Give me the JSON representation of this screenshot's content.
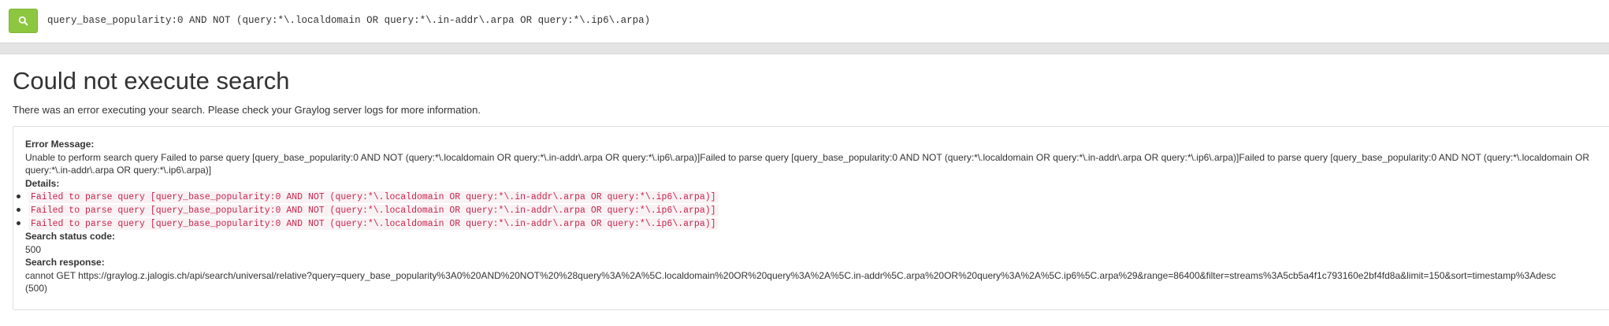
{
  "search": {
    "query": "query_base_popularity:0 AND NOT (query:*\\.localdomain OR query:*\\.in-addr\\.arpa OR query:*\\.ip6\\.arpa)",
    "button_icon": "search-icon",
    "button_color": "#8dc63f"
  },
  "error": {
    "title": "Could not execute search",
    "description": "There was an error executing your search. Please check your Graylog server logs for more information.",
    "message_label": "Error Message:",
    "message_text": "Unable to perform search query Failed to parse query [query_base_popularity:0 AND NOT (query:*\\.localdomain OR query:*\\.in-addr\\.arpa OR query:*\\.ip6\\.arpa)]Failed to parse query [query_base_popularity:0 AND NOT (query:*\\.localdomain OR query:*\\.in-addr\\.arpa OR query:*\\.ip6\\.arpa)]Failed to parse query [query_base_popularity:0 AND NOT (query:*\\.localdomain OR query:*\\.in-addr\\.arpa OR query:*\\.ip6\\.arpa)]",
    "details_label": "Details:",
    "details": [
      "Failed to parse query [query_base_popularity:0 AND NOT (query:*\\.localdomain OR query:*\\.in-addr\\.arpa OR query:*\\.ip6\\.arpa)]",
      "Failed to parse query [query_base_popularity:0 AND NOT (query:*\\.localdomain OR query:*\\.in-addr\\.arpa OR query:*\\.ip6\\.arpa)]",
      "Failed to parse query [query_base_popularity:0 AND NOT (query:*\\.localdomain OR query:*\\.in-addr\\.arpa OR query:*\\.ip6\\.arpa)]"
    ],
    "status_label": "Search status code:",
    "status_code": "500",
    "response_label": "Search response:",
    "response_text": "cannot GET https://graylog.z.jalogis.ch/api/search/universal/relative?query=query_base_popularity%3A0%20AND%20NOT%20%28query%3A%2A%5C.localdomain%20OR%20query%3A%2A%5C.in-addr%5C.arpa%20OR%20query%3A%2A%5C.ip6%5C.arpa%29&range=86400&filter=streams%3A5cb5a4f1c793160e2bf4fd8a&limit=150&sort=timestamp%3Adesc",
    "response_code": "(500)"
  },
  "colors": {
    "accent_green": "#8dc63f",
    "code_text": "#c7254e",
    "code_background": "#f9f2f4"
  }
}
